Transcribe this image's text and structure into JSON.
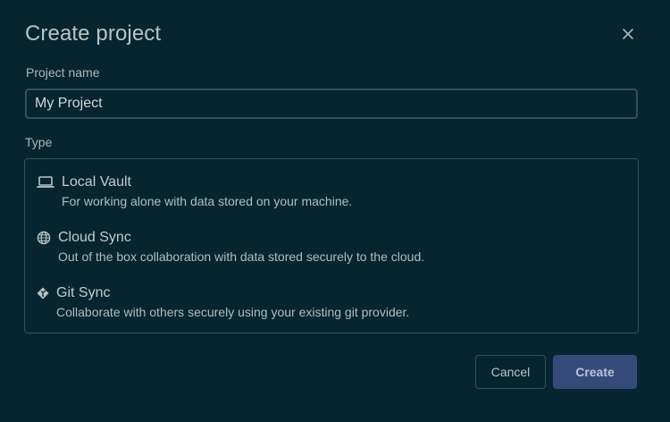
{
  "dialog": {
    "title": "Create project",
    "close_icon": "close-icon"
  },
  "form": {
    "name_label": "Project name",
    "name_value": "My Project",
    "type_label": "Type",
    "types": [
      {
        "icon": "laptop-icon",
        "title": "Local Vault",
        "description": "For working alone with data stored on your machine."
      },
      {
        "icon": "globe-icon",
        "title": "Cloud Sync",
        "description": "Out of the box collaboration with data stored securely to the cloud."
      },
      {
        "icon": "git-icon",
        "title": "Git Sync",
        "description": "Collaborate with others securely using your existing git provider."
      }
    ]
  },
  "actions": {
    "cancel_label": "Cancel",
    "create_label": "Create"
  },
  "colors": {
    "background": "#062530",
    "border": "#35525b",
    "primary_button": "#364a7a"
  }
}
